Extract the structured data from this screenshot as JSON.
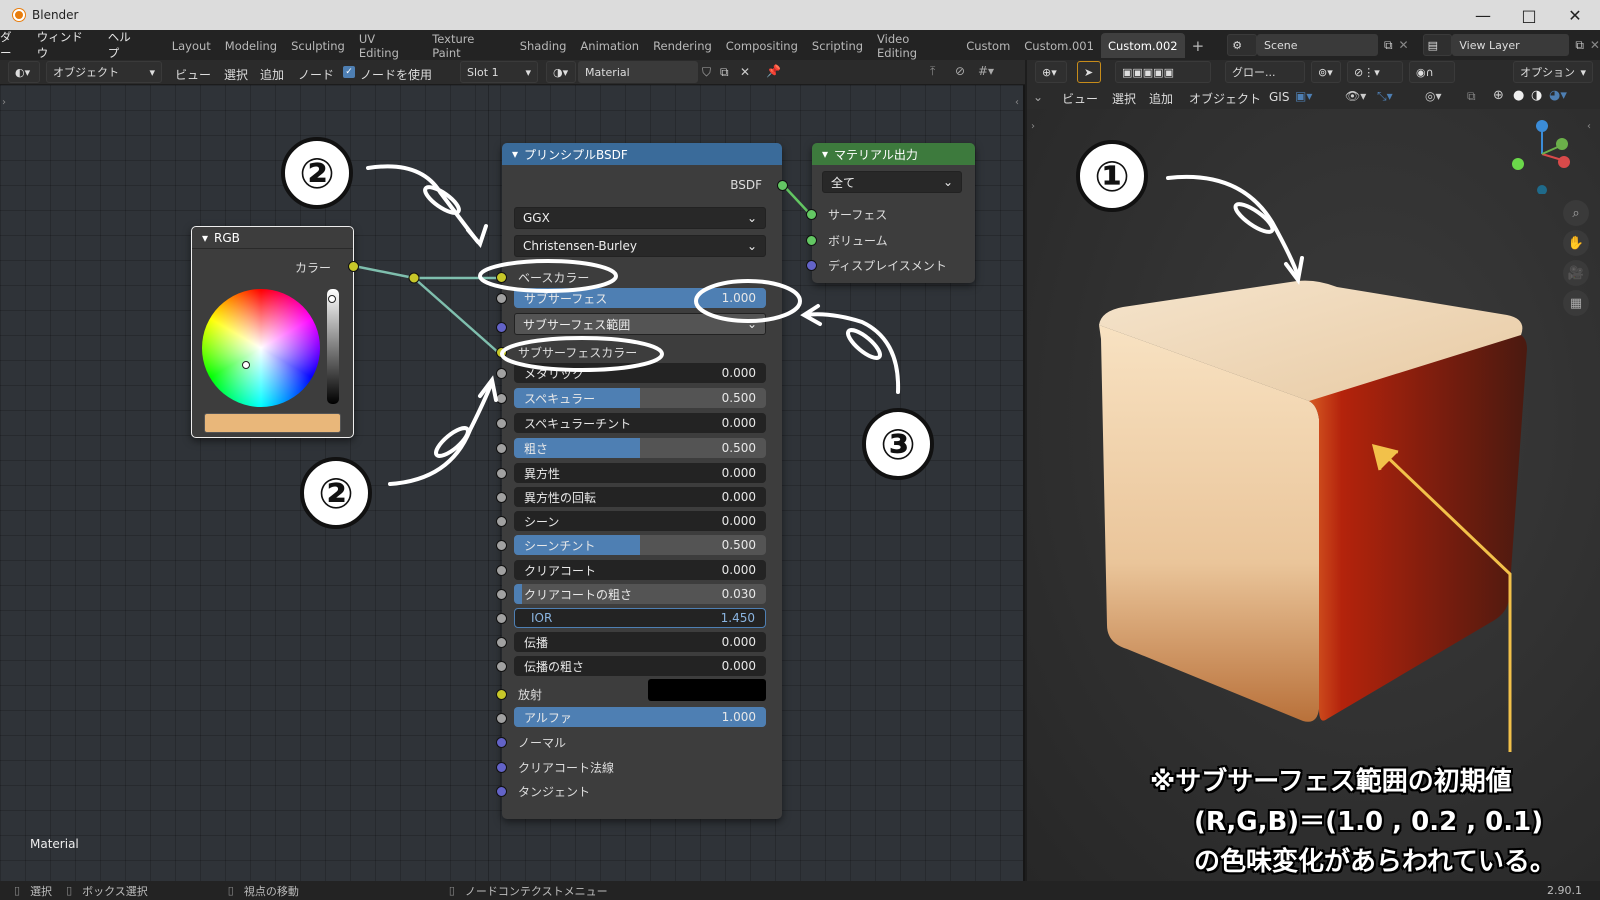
{
  "window": {
    "title": "Blender",
    "version": "2.90.1"
  },
  "menu": {
    "items": [
      "ダー",
      "ウィンドウ",
      "ヘルプ"
    ]
  },
  "workspaces": [
    "Layout",
    "Modeling",
    "Sculpting",
    "UV Editing",
    "Texture Paint",
    "Shading",
    "Animation",
    "Rendering",
    "Compositing",
    "Scripting",
    "Video Editing",
    "Custom",
    "Custom.001",
    "Custom.002"
  ],
  "scene": {
    "name": "Scene",
    "view_layer": "View Layer"
  },
  "node_header": {
    "mode": "オブジェクト",
    "view": "ビュー",
    "select": "選択",
    "add": "追加",
    "node": "ノード",
    "use_nodes": "ノードを使用",
    "slot": "Slot 1",
    "material": "Material"
  },
  "viewport_header": {
    "glow": "グロー...",
    "options": "オプション",
    "view": "ビュー",
    "select": "選択",
    "add": "追加",
    "object": "オブジェクト",
    "gis": "GIS"
  },
  "rgb_node": {
    "title": "RGB",
    "output": "カラー",
    "swatch_color": "#e9b77a"
  },
  "bsdf": {
    "title": "プリンシプルBSDF",
    "output": "BSDF",
    "distribution": "GGX",
    "subsurface_method": "Christensen-Burley",
    "base_color": "ベースカラー",
    "subsurface_color": "サブサーフェスカラー",
    "subsurface_radius": "サブサーフェス範囲",
    "fields": [
      {
        "label": "サブサーフェス",
        "value": "1.000",
        "fill": 1
      },
      {
        "label": "メタリック",
        "value": "0.000",
        "fill": 0
      },
      {
        "label": "スペキュラー",
        "value": "0.500",
        "fill": 0.5
      },
      {
        "label": "スペキュラーチント",
        "value": "0.000",
        "fill": 0
      },
      {
        "label": "粗さ",
        "value": "0.500",
        "fill": 0.5
      },
      {
        "label": "異方性",
        "value": "0.000",
        "fill": 0
      },
      {
        "label": "異方性の回転",
        "value": "0.000",
        "fill": 0
      },
      {
        "label": "シーン",
        "value": "0.000",
        "fill": 0
      },
      {
        "label": "シーンチント",
        "value": "0.500",
        "fill": 0.5
      },
      {
        "label": "クリアコート",
        "value": "0.000",
        "fill": 0
      },
      {
        "label": "クリアコートの粗さ",
        "value": "0.030",
        "fill": 0.03
      },
      {
        "label": "IOR",
        "value": "1.450",
        "fill": 0
      },
      {
        "label": "伝播",
        "value": "0.000",
        "fill": 0
      },
      {
        "label": "伝播の粗さ",
        "value": "0.000",
        "fill": 0
      }
    ],
    "emission": "放射",
    "alpha_label": "アルファ",
    "alpha_value": "1.000",
    "normal": "ノーマル",
    "clearcoat_normal": "クリアコート法線",
    "tangent": "タンジェント"
  },
  "output_node": {
    "title": "マテリアル出力",
    "target": "全て",
    "surface": "サーフェス",
    "volume": "ボリューム",
    "displacement": "ディスプレイスメント"
  },
  "editor_label": "Material",
  "annotations": {
    "one": "①",
    "two": "②",
    "three": "③",
    "note": [
      "※サブサーフェス範囲の初期値",
      "(R,G,B)＝(1.0 , 0.2 , 0.1)",
      "の色味変化があらわれている。"
    ]
  },
  "status": {
    "select": "選択",
    "box_select": "ボックス選択",
    "move_view": "視点の移動",
    "context_menu": "ノードコンテクストメニュー"
  },
  "colors": {
    "socket_yellow": "#c7c729",
    "socket_gray": "#a1a1a1",
    "socket_purple": "#6363c7",
    "socket_green": "#63c763",
    "bsdf_header": "#3a6b9a",
    "output_header": "#3d7a3d",
    "accent": "#4e7fb3"
  }
}
